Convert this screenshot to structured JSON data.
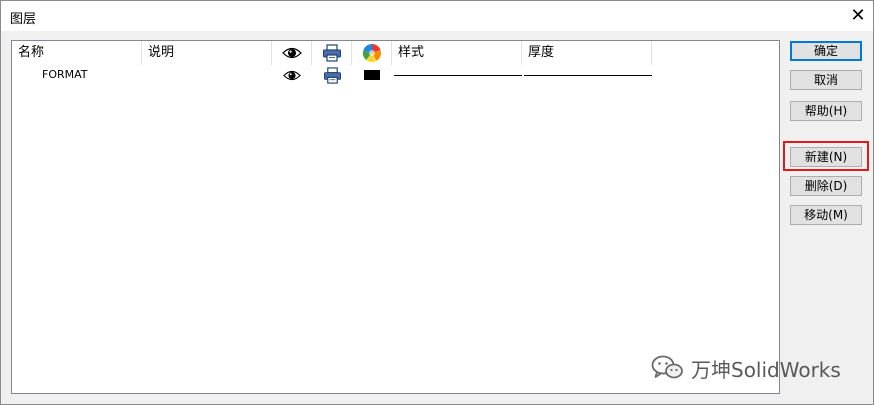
{
  "window": {
    "title": "图层",
    "close_glyph": "✕"
  },
  "list": {
    "columns": {
      "name": "名称",
      "description": "说明",
      "visibility_icon": "eye-icon",
      "print_icon": "printer-icon",
      "color_icon": "color-wheel-icon",
      "style": "样式",
      "thickness": "厚度"
    },
    "rows": [
      {
        "name": "FORMAT",
        "description": "",
        "visible_icon": "eye-icon",
        "print_icon": "printer-icon",
        "color": "#000000"
      }
    ]
  },
  "buttons": {
    "ok": "确定",
    "cancel": "取消",
    "help": "帮助(H)",
    "new": "新建(N)",
    "delete": "删除(D)",
    "move": "移动(M)"
  },
  "colors": {
    "highlight": "#e0191b",
    "default_button_border": "#0078d7"
  },
  "watermark": {
    "text": "万坤SolidWorks",
    "icon": "wechat-icon"
  }
}
